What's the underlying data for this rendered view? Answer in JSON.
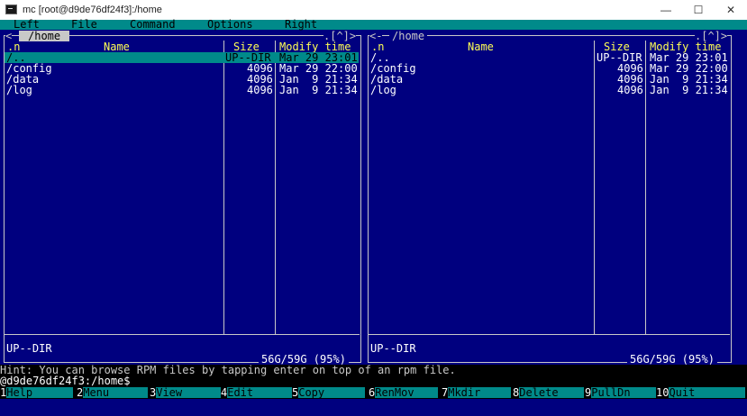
{
  "window": {
    "title": "mc [root@d9de76df24f3]:/home"
  },
  "menu": [
    "Left",
    "File",
    "Command",
    "Options",
    "Right"
  ],
  "left_panel": {
    "path": "/home",
    "history_marker": "<",
    "controls": ".[^]>",
    "headers": {
      "n": ".n",
      "name": "Name",
      "size": "Size",
      "modify": "Modify time"
    },
    "rows": [
      {
        "name": "/..",
        "size": "UP--DIR",
        "modify": "Mar 29 23:01"
      },
      {
        "name": "/config",
        "size": "4096",
        "modify": "Mar 29 22:00"
      },
      {
        "name": "/data",
        "size": "4096",
        "modify": "Jan  9 21:34"
      },
      {
        "name": "/log",
        "size": "4096",
        "modify": "Jan  9 21:34"
      }
    ],
    "status": "UP--DIR",
    "disk": "56G/59G (95%)"
  },
  "right_panel": {
    "path": "/home",
    "history_marker": "<-",
    "controls": ".[^]>",
    "headers": {
      "n": ".n",
      "name": "Name",
      "size": "Size",
      "modify": "Modify time"
    },
    "rows": [
      {
        "name": "/..",
        "size": "UP--DIR",
        "modify": "Mar 29 23:01"
      },
      {
        "name": "/config",
        "size": "4096",
        "modify": "Mar 29 22:00"
      },
      {
        "name": "/data",
        "size": "4096",
        "modify": "Jan  9 21:34"
      },
      {
        "name": "/log",
        "size": "4096",
        "modify": "Jan  9 21:34"
      }
    ],
    "status": "UP--DIR",
    "disk": "56G/59G (95%)"
  },
  "hint": "Hint: You can browse RPM files by tapping enter on top of an rpm file.",
  "prompt": "@d9de76df24f3:/home$",
  "function_keys": [
    {
      "num": "1",
      "label": "Help"
    },
    {
      "num": "2",
      "label": "Menu"
    },
    {
      "num": "3",
      "label": "View"
    },
    {
      "num": "4",
      "label": "Edit"
    },
    {
      "num": "5",
      "label": "Copy"
    },
    {
      "num": "6",
      "label": "RenMov"
    },
    {
      "num": "7",
      "label": "Mkdir"
    },
    {
      "num": "8",
      "label": "Delete"
    },
    {
      "num": "9",
      "label": "PullDn"
    },
    {
      "num": "10",
      "label": "Quit"
    }
  ]
}
